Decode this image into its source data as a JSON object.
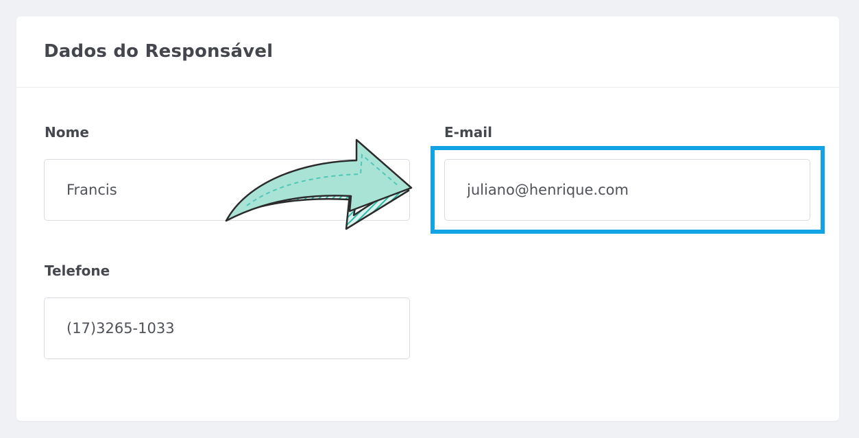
{
  "card": {
    "title": "Dados do Responsável"
  },
  "fields": {
    "nome": {
      "label": "Nome",
      "value": "Francis"
    },
    "email": {
      "label": "E-mail",
      "value": "juliano@henrique.com"
    },
    "telefone": {
      "label": "Telefone",
      "value": "(17)3265-1033"
    }
  },
  "annotations": {
    "highlight_color": "#11a3e3",
    "arrow_fill": "#a8e3d6",
    "arrow_hatch": "#2fb8a8",
    "arrow_icon": "curved-arrow-icon"
  }
}
